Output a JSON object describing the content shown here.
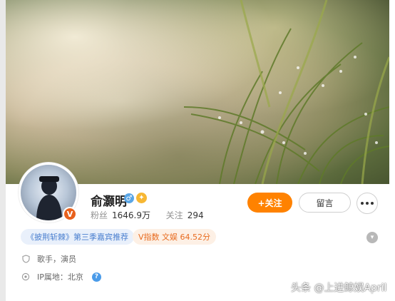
{
  "profile": {
    "name": "俞灏明",
    "gender_symbol": "♂",
    "level_symbol": "✦",
    "verified_badge": "V",
    "stats": {
      "fans_label": "粉丝",
      "fans_value": "1646.9万",
      "following_label": "关注",
      "following_value": "294"
    }
  },
  "actions": {
    "follow_label": "+关注",
    "message_label": "留言"
  },
  "tags": {
    "show_recommend": "《披荆斩棘》第三季嘉宾推荐",
    "v_index": "V指数 文娱 64.52分"
  },
  "info": {
    "profession": "歌手，演员",
    "ip_location": "IP属地：北京",
    "help_symbol": "?"
  },
  "watermark": "头条 @上进鲸娱April",
  "colors": {
    "accent_orange": "#ff8200",
    "tag_blue": "#4a7fcf",
    "tag_orange": "#e86b1f",
    "help_blue": "#4a9be9"
  },
  "icons": {
    "more": "more-dots-icon",
    "profession": "shield-icon",
    "ip": "location-icon",
    "expand": "chevron-down-icon"
  }
}
